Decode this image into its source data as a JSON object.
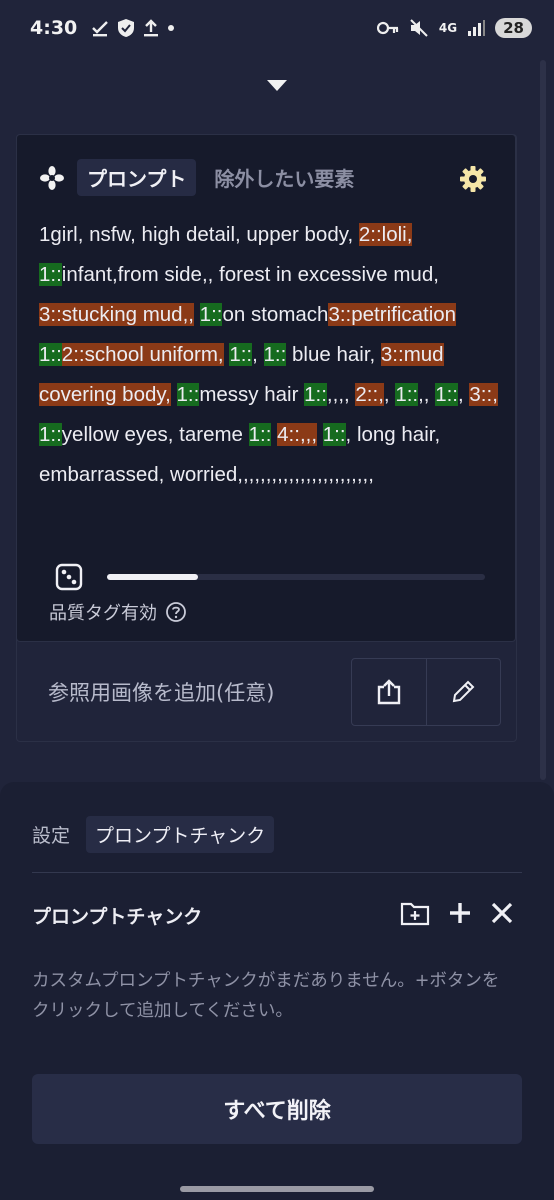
{
  "status": {
    "time": "4:30",
    "network": "4G",
    "battery": "28"
  },
  "tabs": {
    "active": "プロンプト",
    "inactive": "除外したい要素"
  },
  "prompt": [
    {
      "t": "1girl, nsfw, high detail, upper body, ",
      "h": ""
    },
    {
      "t": "2::loli,",
      "h": "r"
    },
    {
      "t": " ",
      "h": ""
    },
    {
      "t": "1::",
      "h": "g"
    },
    {
      "t": "infant,from side,, forest in excessive mud, ",
      "h": ""
    },
    {
      "t": "3::stucking mud,,",
      "h": "r"
    },
    {
      "t": " ",
      "h": ""
    },
    {
      "t": "1::",
      "h": "g"
    },
    {
      "t": "on stomach",
      "h": ""
    },
    {
      "t": "3::petrification",
      "h": "r"
    },
    {
      "t": " ",
      "h": ""
    },
    {
      "t": "1::",
      "h": "g"
    },
    {
      "t": "2::school uniform,",
      "h": "r"
    },
    {
      "t": " ",
      "h": ""
    },
    {
      "t": "1::",
      "h": "g"
    },
    {
      "t": ", ",
      "h": ""
    },
    {
      "t": "1::",
      "h": "g"
    },
    {
      "t": " blue hair, ",
      "h": ""
    },
    {
      "t": "3::mud covering body,",
      "h": "r"
    },
    {
      "t": " ",
      "h": ""
    },
    {
      "t": "1::",
      "h": "g"
    },
    {
      "t": "messy hair ",
      "h": ""
    },
    {
      "t": "1::",
      "h": "g"
    },
    {
      "t": ",,,, ",
      "h": ""
    },
    {
      "t": "2::,",
      "h": "r"
    },
    {
      "t": ", ",
      "h": ""
    },
    {
      "t": "1::",
      "h": "g"
    },
    {
      "t": ",, ",
      "h": ""
    },
    {
      "t": "1::",
      "h": "g"
    },
    {
      "t": ", ",
      "h": ""
    },
    {
      "t": "3::,",
      "h": "r"
    },
    {
      "t": " ",
      "h": ""
    },
    {
      "t": "1::",
      "h": "g"
    },
    {
      "t": "yellow eyes, tareme ",
      "h": ""
    },
    {
      "t": "1::",
      "h": "g"
    },
    {
      "t": " ",
      "h": ""
    },
    {
      "t": "4::,,,",
      "h": "r"
    },
    {
      "t": " ",
      "h": ""
    },
    {
      "t": "1::",
      "h": "g"
    },
    {
      "t": ", long hair, embarrassed, worried,,,,,,,,,,,,,,,,,,,,,,,,",
      "h": ""
    }
  ],
  "quality_label": "品質タグ有効",
  "slider_level": 0.24,
  "reference_label": "参照用画像を追加(任意)",
  "sheet": {
    "crumb_settings": "設定",
    "crumb_current": "プロンプトチャンク",
    "title": "プロンプトチャンク",
    "empty_message": "カスタムプロンプトチャンクがまだありません。+ボタンをクリックして追加してください。",
    "delete_all": "すべて削除"
  },
  "colors": {
    "highlight_red": "#8b3a17",
    "highlight_green": "#166b1f",
    "accent_gear": "#f5e6a8"
  }
}
